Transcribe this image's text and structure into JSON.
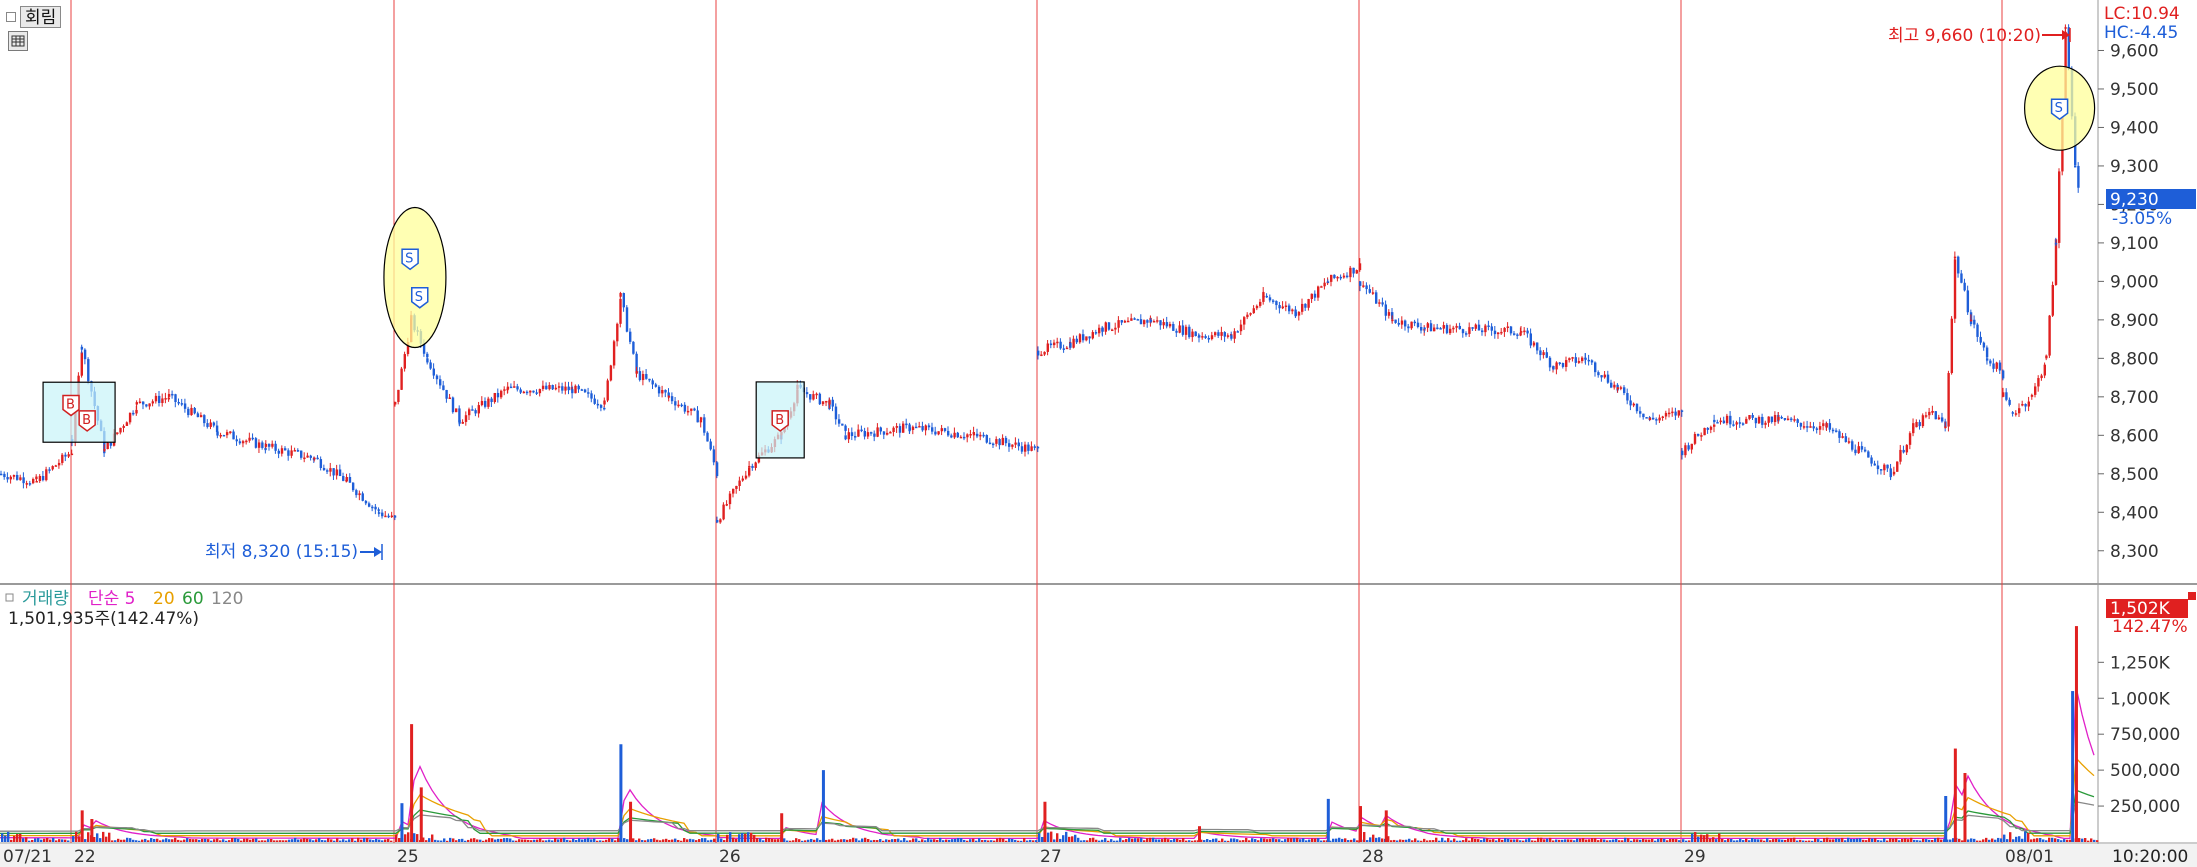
{
  "toolbar": {
    "chart_mode_label": "회림",
    "grid_icon": "grid-icon"
  },
  "colors": {
    "up": "#e02020",
    "down": "#1e5ed8",
    "ma5": "#e020c8",
    "ma20": "#e8a000",
    "ma60": "#2a9a3a",
    "ma120": "#888888",
    "session_line": "#e84040",
    "marker_fill": "#ffff99",
    "buy_box": "#c8f4f8"
  },
  "price_axis": {
    "ticks": [
      "9,600",
      "9,500",
      "9,400",
      "9,300",
      "9,200",
      "9,100",
      "9,000",
      "8,900",
      "8,800",
      "8,700",
      "8,600",
      "8,500",
      "8,400",
      "8,300"
    ],
    "lc_label": "LC:10.94",
    "hc_label": "HC:-4.45",
    "current_price": "9,230",
    "current_change": "-3.05%"
  },
  "annotations": {
    "high_label": "최고 9,660 (10:20)",
    "low_label": "최저 8,320 (15:15)"
  },
  "volume_panel": {
    "legend_title": "거래량",
    "legend_ma": [
      "단순 5",
      "20",
      "60",
      "120"
    ],
    "summary": "1,501,935주(142.47%)",
    "current_volume": "1,502K",
    "current_pct": "142.47%",
    "ticks": [
      "1,250K",
      "1,000K",
      "750,000",
      "500,000",
      "250,000"
    ]
  },
  "time_axis": {
    "labels": [
      "07/21",
      "22",
      "25",
      "26",
      "27",
      "28",
      "29",
      "08/01"
    ],
    "current_time": "10:20:00"
  },
  "chart_data": {
    "type": "candlestick",
    "title": "",
    "x_categories": [
      "07/21",
      "07/22",
      "07/25",
      "07/26",
      "07/27",
      "07/28",
      "07/29",
      "08/01"
    ],
    "price_ylim": [
      8250,
      9700
    ],
    "price_path": [
      {
        "day": "07/21",
        "t": 0.0,
        "price": 8500
      },
      {
        "day": "07/21",
        "t": 0.5,
        "price": 8480
      },
      {
        "day": "07/21",
        "t": 1.0,
        "price": 8560
      },
      {
        "day": "07/22",
        "t": 0.0,
        "price": 8590
      },
      {
        "day": "07/22",
        "t": 0.03,
        "price": 8830
      },
      {
        "day": "07/22",
        "t": 0.1,
        "price": 8560
      },
      {
        "day": "07/22",
        "t": 0.2,
        "price": 8680
      },
      {
        "day": "07/22",
        "t": 0.3,
        "price": 8700
      },
      {
        "day": "07/22",
        "t": 0.45,
        "price": 8610
      },
      {
        "day": "07/22",
        "t": 0.6,
        "price": 8570
      },
      {
        "day": "07/22",
        "t": 0.75,
        "price": 8540
      },
      {
        "day": "07/22",
        "t": 0.85,
        "price": 8480
      },
      {
        "day": "07/22",
        "t": 0.95,
        "price": 8400
      },
      {
        "day": "07/22",
        "t": 1.0,
        "price": 8380
      },
      {
        "day": "07/25",
        "t": 0.0,
        "price": 8680
      },
      {
        "day": "07/25",
        "t": 0.05,
        "price": 8900
      },
      {
        "day": "07/25",
        "t": 0.1,
        "price": 8800
      },
      {
        "day": "07/25",
        "t": 0.2,
        "price": 8640
      },
      {
        "day": "07/25",
        "t": 0.35,
        "price": 8720
      },
      {
        "day": "07/25",
        "t": 0.55,
        "price": 8720
      },
      {
        "day": "07/25",
        "t": 0.65,
        "price": 8680
      },
      {
        "day": "07/25",
        "t": 0.7,
        "price": 8960
      },
      {
        "day": "07/25",
        "t": 0.75,
        "price": 8760
      },
      {
        "day": "07/25",
        "t": 0.85,
        "price": 8700
      },
      {
        "day": "07/25",
        "t": 0.95,
        "price": 8640
      },
      {
        "day": "07/25",
        "t": 1.0,
        "price": 8500
      },
      {
        "day": "07/26",
        "t": 0.0,
        "price": 8380
      },
      {
        "day": "07/26",
        "t": 0.1,
        "price": 8520
      },
      {
        "day": "07/26",
        "t": 0.2,
        "price": 8600
      },
      {
        "day": "07/26",
        "t": 0.25,
        "price": 8720
      },
      {
        "day": "07/26",
        "t": 0.35,
        "price": 8680
      },
      {
        "day": "07/26",
        "t": 0.4,
        "price": 8600
      },
      {
        "day": "07/26",
        "t": 0.6,
        "price": 8620
      },
      {
        "day": "07/26",
        "t": 0.8,
        "price": 8600
      },
      {
        "day": "07/26",
        "t": 1.0,
        "price": 8560
      },
      {
        "day": "07/27",
        "t": 0.0,
        "price": 8820
      },
      {
        "day": "07/27",
        "t": 0.1,
        "price": 8840
      },
      {
        "day": "07/27",
        "t": 0.2,
        "price": 8880
      },
      {
        "day": "07/27",
        "t": 0.35,
        "price": 8900
      },
      {
        "day": "07/27",
        "t": 0.5,
        "price": 8860
      },
      {
        "day": "07/27",
        "t": 0.6,
        "price": 8860
      },
      {
        "day": "07/27",
        "t": 0.7,
        "price": 8960
      },
      {
        "day": "07/27",
        "t": 0.8,
        "price": 8920
      },
      {
        "day": "07/27",
        "t": 0.9,
        "price": 9000
      },
      {
        "day": "07/27",
        "t": 1.0,
        "price": 9040
      },
      {
        "day": "07/28",
        "t": 0.0,
        "price": 9000
      },
      {
        "day": "07/28",
        "t": 0.1,
        "price": 8900
      },
      {
        "day": "07/28",
        "t": 0.2,
        "price": 8880
      },
      {
        "day": "07/28",
        "t": 0.5,
        "price": 8870
      },
      {
        "day": "07/28",
        "t": 0.6,
        "price": 8780
      },
      {
        "day": "07/28",
        "t": 0.7,
        "price": 8800
      },
      {
        "day": "07/28",
        "t": 0.8,
        "price": 8720
      },
      {
        "day": "07/28",
        "t": 0.9,
        "price": 8640
      },
      {
        "day": "07/28",
        "t": 1.0,
        "price": 8660
      },
      {
        "day": "07/29",
        "t": 0.0,
        "price": 8560
      },
      {
        "day": "07/29",
        "t": 0.1,
        "price": 8640
      },
      {
        "day": "07/29",
        "t": 0.3,
        "price": 8640
      },
      {
        "day": "07/29",
        "t": 0.45,
        "price": 8620
      },
      {
        "day": "07/29",
        "t": 0.55,
        "price": 8560
      },
      {
        "day": "07/29",
        "t": 0.65,
        "price": 8500
      },
      {
        "day": "07/29",
        "t": 0.72,
        "price": 8620
      },
      {
        "day": "07/29",
        "t": 0.78,
        "price": 8660
      },
      {
        "day": "07/29",
        "t": 0.82,
        "price": 8620
      },
      {
        "day": "07/29",
        "t": 0.85,
        "price": 9060
      },
      {
        "day": "07/29",
        "t": 0.9,
        "price": 8900
      },
      {
        "day": "07/29",
        "t": 0.95,
        "price": 8800
      },
      {
        "day": "07/29",
        "t": 1.0,
        "price": 8760
      },
      {
        "day": "08/01",
        "t": 0.0,
        "price": 8700
      },
      {
        "day": "08/01",
        "t": 0.1,
        "price": 8660
      },
      {
        "day": "08/01",
        "t": 0.2,
        "price": 8680
      },
      {
        "day": "08/01",
        "t": 0.3,
        "price": 8700
      },
      {
        "day": "08/01",
        "t": 0.45,
        "price": 8800
      },
      {
        "day": "08/01",
        "t": 0.55,
        "price": 9100
      },
      {
        "day": "08/01",
        "t": 0.65,
        "price": 9660
      },
      {
        "day": "08/01",
        "t": 0.75,
        "price": 9300
      },
      {
        "day": "08/01",
        "t": 0.8,
        "price": 9230
      }
    ],
    "high": {
      "price": 9660,
      "time": "10:20"
    },
    "low": {
      "price": 8320,
      "time": "15:15"
    },
    "signals": [
      {
        "type": "B",
        "day": "07/22",
        "t": 0.0,
        "price": 8680
      },
      {
        "type": "B",
        "day": "07/22",
        "t": 0.05,
        "price": 8640
      },
      {
        "type": "S",
        "day": "07/25",
        "t": 0.05,
        "price": 9060
      },
      {
        "type": "S",
        "day": "07/25",
        "t": 0.08,
        "price": 8960
      },
      {
        "type": "B",
        "day": "07/26",
        "t": 0.2,
        "price": 8640
      },
      {
        "type": "S",
        "day": "08/01",
        "t": 0.6,
        "price": 9450
      }
    ],
    "volume_ylim": [
      0,
      1600000
    ],
    "volume_spikes": [
      {
        "day": "07/22",
        "t": 0.03,
        "value": 220000
      },
      {
        "day": "07/22",
        "t": 0.06,
        "value": 160000
      },
      {
        "day": "07/25",
        "t": 0.02,
        "value": 270000
      },
      {
        "day": "07/25",
        "t": 0.05,
        "value": 820000
      },
      {
        "day": "07/25",
        "t": 0.08,
        "value": 380000
      },
      {
        "day": "07/25",
        "t": 0.7,
        "value": 680000
      },
      {
        "day": "07/25",
        "t": 0.73,
        "value": 280000
      },
      {
        "day": "07/26",
        "t": 0.2,
        "value": 200000
      },
      {
        "day": "07/26",
        "t": 0.33,
        "value": 500000
      },
      {
        "day": "07/27",
        "t": 0.02,
        "value": 280000
      },
      {
        "day": "07/27",
        "t": 0.5,
        "value": 110000
      },
      {
        "day": "07/27",
        "t": 0.9,
        "value": 300000
      },
      {
        "day": "07/28",
        "t": 0.0,
        "value": 250000
      },
      {
        "day": "07/28",
        "t": 0.08,
        "value": 220000
      },
      {
        "day": "07/29",
        "t": 0.82,
        "value": 320000
      },
      {
        "day": "07/29",
        "t": 0.85,
        "value": 650000
      },
      {
        "day": "07/29",
        "t": 0.88,
        "value": 480000
      },
      {
        "day": "08/01",
        "t": 0.72,
        "value": 1050000
      },
      {
        "day": "08/01",
        "t": 0.76,
        "value": 1502000
      }
    ]
  }
}
